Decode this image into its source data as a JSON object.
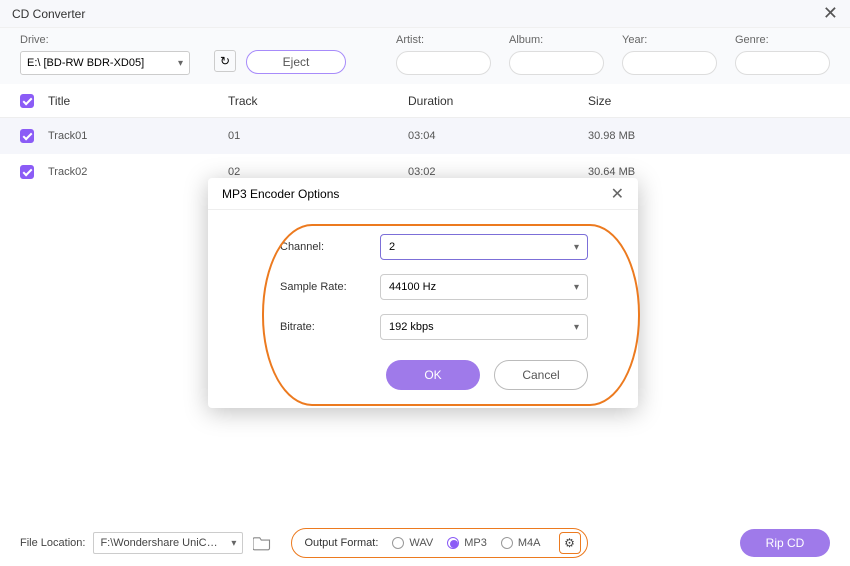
{
  "window": {
    "title": "CD Converter"
  },
  "toolbar": {
    "drive_label": "Drive:",
    "drive_value": "E:\\ [BD-RW  BDR-XD05]",
    "eject_label": "Eject",
    "artist_label": "Artist:",
    "album_label": "Album:",
    "year_label": "Year:",
    "genre_label": "Genre:"
  },
  "columns": {
    "title": "Title",
    "track": "Track",
    "duration": "Duration",
    "size": "Size"
  },
  "tracks": [
    {
      "title": "Track01",
      "track": "01",
      "duration": "03:04",
      "size": "30.98 MB"
    },
    {
      "title": "Track02",
      "track": "02",
      "duration": "03:02",
      "size": "30.64 MB"
    }
  ],
  "modal": {
    "title": "MP3 Encoder Options",
    "channel_label": "Channel:",
    "channel_value": "2",
    "samplerate_label": "Sample Rate:",
    "samplerate_value": "44100 Hz",
    "bitrate_label": "Bitrate:",
    "bitrate_value": "192 kbps",
    "ok": "OK",
    "cancel": "Cancel"
  },
  "footer": {
    "file_location_label": "File Location:",
    "file_location_value": "F:\\Wondershare UniConverter",
    "output_format_label": "Output Format:",
    "formats": {
      "wav": "WAV",
      "mp3": "MP3",
      "m4a": "M4A"
    },
    "selected_format": "MP3",
    "rip_label": "Rip CD"
  }
}
